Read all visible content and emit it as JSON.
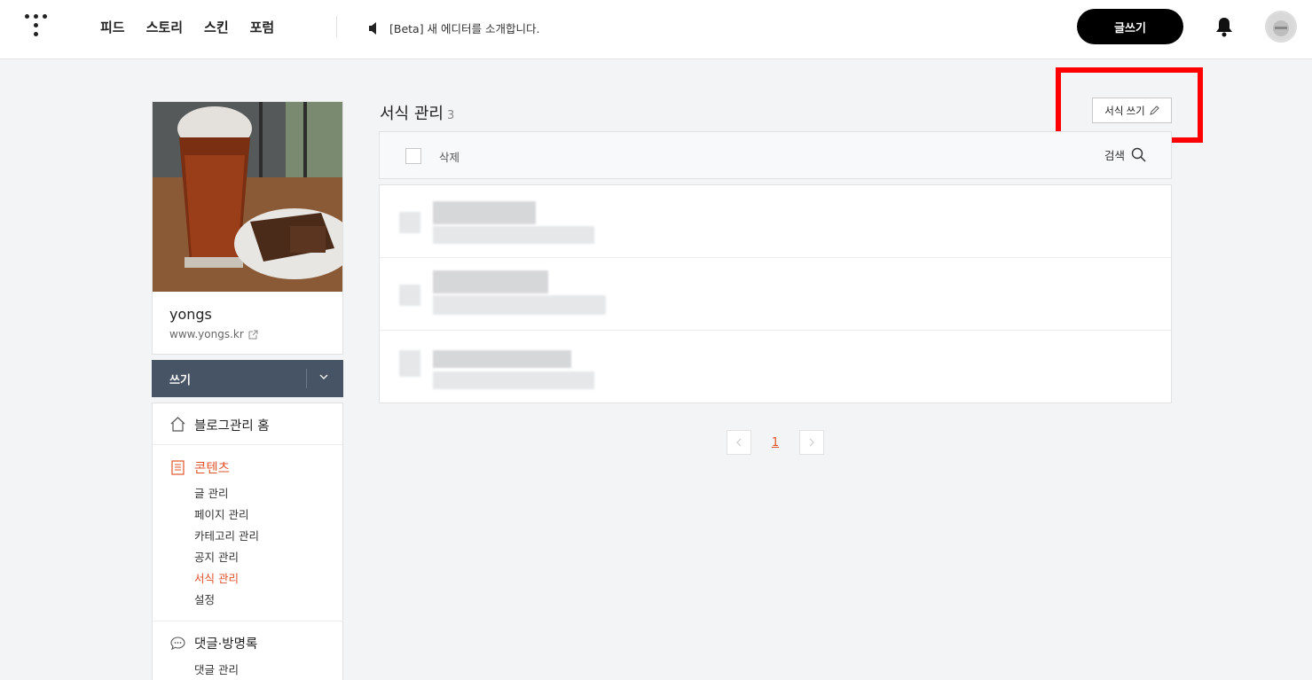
{
  "topnav": {
    "items": [
      "피드",
      "스토리",
      "스킨",
      "포럼"
    ],
    "notice": "[Beta] 새 에디터를 소개합니다.",
    "write_button": "글쓰기"
  },
  "profile": {
    "name": "yongs",
    "url": "www.yongs.kr"
  },
  "write_dropdown": {
    "label": "쓰기"
  },
  "menu": {
    "home": "블로그관리 홈",
    "contents": {
      "title": "콘텐츠",
      "items": [
        "글 관리",
        "페이지 관리",
        "카테고리 관리",
        "공지 관리",
        "서식 관리",
        "설정"
      ]
    },
    "comments": {
      "title": "댓글·방명록",
      "items": [
        "댓글 관리"
      ]
    }
  },
  "main": {
    "title": "서식 관리",
    "count": "3",
    "template_write_button": "서식 쓰기",
    "toolbar": {
      "delete": "삭제",
      "search": "검색"
    },
    "pagination": {
      "current": "1"
    }
  },
  "colors": {
    "accent": "#e2532a",
    "highlight": "#ff0000",
    "dropdown_bg": "#475466"
  }
}
